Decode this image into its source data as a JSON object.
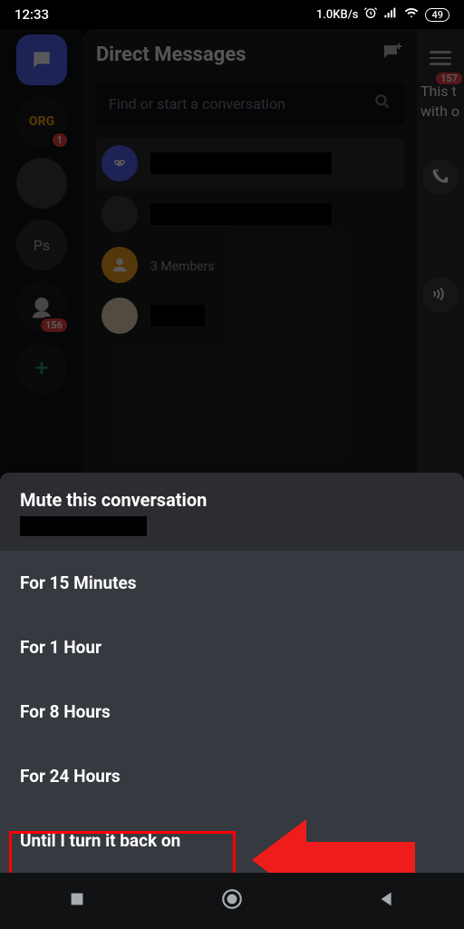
{
  "status": {
    "time": "12:33",
    "network_speed": "1.0KB/s",
    "battery": "49"
  },
  "server_rail": {
    "badges": {
      "org": "1",
      "guild": "156"
    },
    "ps_label": "Ps",
    "peek_badge": "157"
  },
  "dm": {
    "title": "Direct Messages",
    "search_placeholder": "Find or start a conversation",
    "group_members": "3 Members"
  },
  "peek": {
    "text_line1": "This t",
    "text_line2": "with o"
  },
  "sheet": {
    "title": "Mute this conversation",
    "options": [
      "For 15 Minutes",
      "For 1 Hour",
      "For 8 Hours",
      "For 24 Hours",
      "Until I turn it back on"
    ]
  }
}
